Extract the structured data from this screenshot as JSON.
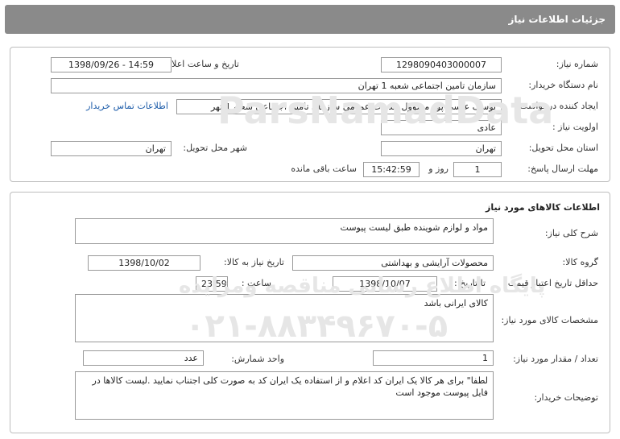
{
  "header": {
    "title": "جزئیات اطلاعات نیاز"
  },
  "need": {
    "number_label": "شماره نیاز:",
    "number": "1298090403000007",
    "announce_label": "تاریخ و ساعت اعلان عمومی:",
    "announce": "1398/09/26 - 14:59",
    "buyer_label": "نام دستگاه خریدار:",
    "buyer": "سازمان تامین اجتماعی شعبه 1 تهران",
    "creator_label": "ایجاد کننده درخواست:",
    "creator": "یوسف  عیسی پور مسؤول خدمات عمومی سازمان تامین اجتماعی شعبه 1 تهر",
    "contact_link": "اطلاعات تماس خریدار",
    "priority_label": "اولویت نیاز :",
    "priority": "عادی",
    "province_label": "استان محل تحویل:",
    "province": "تهران",
    "city_label": "شهر محل تحویل:",
    "city": "تهران",
    "deadline_label": "مهلت ارسال پاسخ:",
    "days": "1",
    "days_unit": "روز و",
    "time": "15:42:59",
    "remaining": "ساعت باقی مانده"
  },
  "goods": {
    "section_title": "اطلاعات کالاهای مورد نیاز",
    "desc_label": "شرح کلی نیاز:",
    "desc": "مواد و لوازم شوینده طبق لیست پیوست",
    "group_label": "گروه کالا:",
    "group": "محصولات آرایشی و بهداشتی",
    "need_date_label": "تاریخ نیاز به کالا:",
    "need_date": "1398/10/02",
    "min_valid_label": "حداقل تاریخ اعتبار قیمت:",
    "to_date_label": "تا تاریخ :",
    "to_date": "1398/10/07",
    "hour_label": "ساعت :",
    "hour": "23:59",
    "specs_label": "مشخصات کالای مورد نیاز:",
    "specs": "کالای ایرانی باشد",
    "qty_label": "تعداد / مقدار مورد نیاز:",
    "qty": "1",
    "unit_label": "واحد شمارش:",
    "unit": "عدد",
    "notes_label": "توضیحات خریدار:",
    "notes": "لطفا\" برای هر کالا یک ایران کد اعلام  و از استفاده یک ایران کد به صورت کلی اجتناب نمایید .لیست کالاها در فایل پیوست موجود است"
  },
  "watermark": {
    "brand": "ParsNamadData",
    "text": "پایگاه اطلاع رسانی مناقصه ومزایده",
    "phone": "۰۲۱-۸۸۳۴۹۶۷۰-۵"
  }
}
